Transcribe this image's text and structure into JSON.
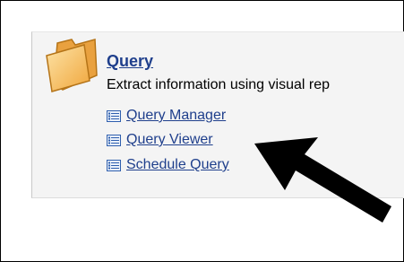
{
  "section": {
    "title": "Query",
    "description": "Extract information using visual rep",
    "icon": "folder-icon"
  },
  "links": [
    {
      "label": "Query Manager",
      "icon": "list-icon"
    },
    {
      "label": "Query Viewer",
      "icon": "list-icon"
    },
    {
      "label": "Schedule Query",
      "icon": "list-icon"
    }
  ],
  "annotation": {
    "icon": "arrow-icon",
    "color": "#000000"
  },
  "colors": {
    "link": "#1f3f8c",
    "panel": "#f4f4f4",
    "folder": "#f5b351"
  }
}
